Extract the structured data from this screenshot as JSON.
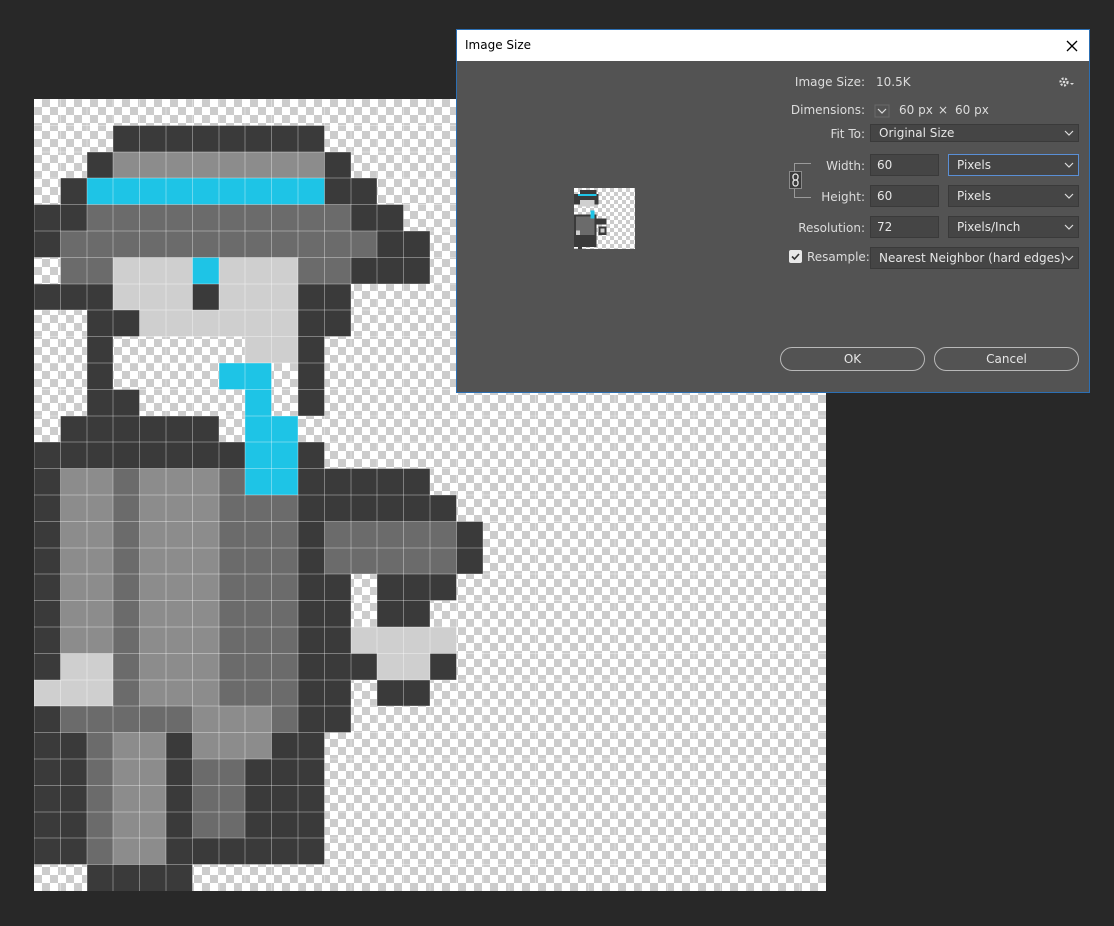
{
  "dialog": {
    "title": "Image Size",
    "image_size_label": "Image Size:",
    "image_size_value": "10.5K",
    "dimensions_label": "Dimensions:",
    "dim_width": "60 px",
    "dim_sep": "×",
    "dim_height": "60 px",
    "fit_to_label": "Fit To:",
    "fit_to_value": "Original Size",
    "width_label": "Width:",
    "width_value": "60",
    "width_unit": "Pixels",
    "height_label": "Height:",
    "height_value": "60",
    "height_unit": "Pixels",
    "resolution_label": "Resolution:",
    "resolution_value": "72",
    "resolution_unit": "Pixels/Inch",
    "resample_label": "Resample:",
    "resample_checked": true,
    "resample_value": "Nearest Neighbor (hard edges)",
    "ok_label": "OK",
    "cancel_label": "Cancel"
  },
  "icons": {
    "close": "close-icon",
    "settings": "gear-icon",
    "dimensions_toggle": "chevron-down-icon",
    "link": "chain-link-icon",
    "dropdown": "chevron-down-icon",
    "checkbox": "checkmark-icon"
  },
  "colors": {
    "app_background": "#282828",
    "dialog_background": "#535353",
    "titlebar": "#ffffff",
    "accent_cyan": "#1ec4e6",
    "sprite_dark": "#3a3a3a",
    "sprite_mid": "#6b6b6b",
    "sprite_light": "#8c8c8c",
    "sprite_pale": "#cfcfcf"
  }
}
